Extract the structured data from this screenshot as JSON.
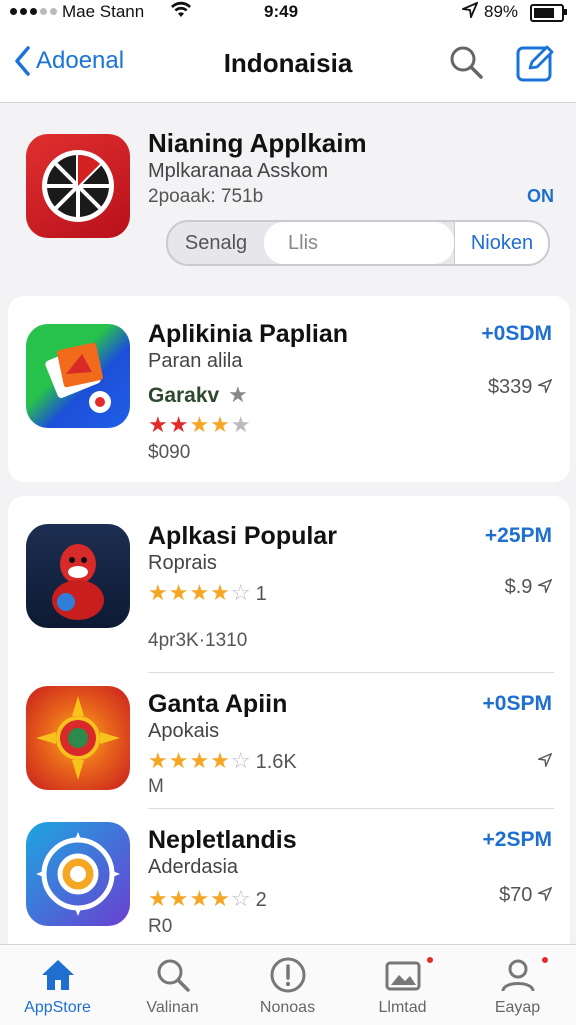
{
  "status_bar": {
    "carrier": "Mae Stann",
    "time": "9:49",
    "battery_pct": "89%",
    "battery_level": 0.89
  },
  "nav": {
    "back_label": "Adoenal",
    "title": "Indonaisia"
  },
  "featured": {
    "name": "Nianing Applkaim",
    "subtitle": "Mplkaranaa Asskom",
    "meta": "2poaak: 751b",
    "badge": "ON",
    "segments": [
      "Senalg",
      "Llis",
      "Nioken"
    ]
  },
  "cards": [
    {
      "name": "Aplikinia Paplian",
      "subtitle": "Paran alila",
      "developer": "Garakv",
      "rating_stars": "★★★★★",
      "rating_value": 3,
      "size": "$090",
      "price": "+0SDM",
      "secondary": "$339"
    }
  ],
  "list": [
    {
      "name": "Aplkasi Popular",
      "subtitle": "Roprais",
      "rating_stars": "★★★★☆",
      "rating_value": 4.5,
      "rating_count": "1",
      "meta": "4pr3K·1310",
      "price": "+25PM",
      "secondary": "$.9"
    },
    {
      "name": "Ganta Apiin",
      "subtitle": "Apokais",
      "rating_stars": "★★★★☆",
      "rating_value": 4.5,
      "rating_count": "1.6K",
      "meta": "M",
      "price": "+0SPM",
      "secondary": ""
    },
    {
      "name": "Nepletlandis",
      "subtitle": "Aderdasia",
      "rating_stars": "★★★★☆",
      "rating_value": 4,
      "rating_count": "2",
      "meta": "R0",
      "price": "+2SPM",
      "secondary": "$70"
    }
  ],
  "tabs": [
    {
      "label": "AppStore",
      "icon": "home-icon",
      "active": true
    },
    {
      "label": "Valinan",
      "icon": "search-icon",
      "active": false
    },
    {
      "label": "Nonoas",
      "icon": "info-icon",
      "active": false
    },
    {
      "label": "Llmtad",
      "icon": "image-icon",
      "active": false
    },
    {
      "label": "Eayap",
      "icon": "person-icon",
      "active": false
    }
  ],
  "colors": {
    "accent": "#1f6fd1",
    "star": "#f5a623",
    "badge_red": "#e22b2b"
  }
}
